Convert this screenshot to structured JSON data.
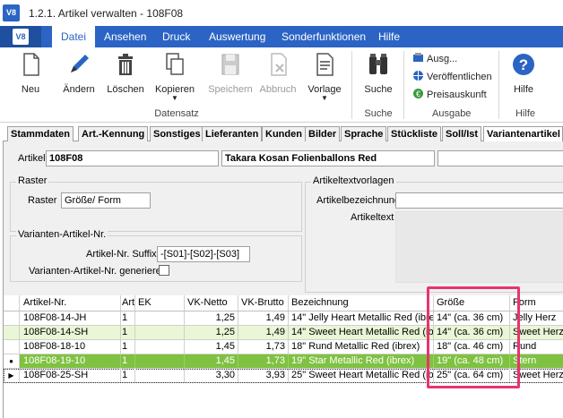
{
  "window": {
    "title": "1.2.1. Artikel verwalten - 108F08",
    "app_icon": "V8"
  },
  "ribbon_tabs": [
    "Datei",
    "Ansehen",
    "Druck",
    "Auswertung",
    "Sonderfunktionen",
    "Hilfe"
  ],
  "ribbon": {
    "buttons": {
      "neu": "Neu",
      "aendern": "Ändern",
      "loeschen": "Löschen",
      "kopieren": "Kopieren",
      "speichern": "Speichern",
      "abbruch": "Abbruch",
      "vorlage": "Vorlage",
      "suche": "Suche",
      "hilfe": "Hilfe"
    },
    "small": {
      "ausg": "Ausg...",
      "veroeffentlichen": "Veröffentlichen",
      "preisauskunft": "Preisauskunft"
    },
    "groups": {
      "datensatz": "Datensatz",
      "suche": "Suche",
      "ausgabe": "Ausgabe",
      "hilfe": "Hilfe"
    }
  },
  "page_tabs": [
    "Stammdaten",
    "Art.-Kennung",
    "Sonstiges",
    "Lieferanten",
    "Kunden",
    "Bilder",
    "Sprache",
    "Stückliste",
    "Soll/Ist",
    "Variantenartikel"
  ],
  "artikel": {
    "label": "Artikel",
    "number": "108F08",
    "name": "Takara Kosan Folienballons Red"
  },
  "raster": {
    "group": "Raster",
    "label": "Raster",
    "value": "Größe/ Form"
  },
  "varianten": {
    "group": "Varianten-Artikel-Nr.",
    "suffix_label": "Artikel-Nr. Suffix",
    "suffix_value": "-[S01]-[S02]-[S03]",
    "generate_label": "Varianten-Artikel-Nr. generieren"
  },
  "textvorlagen": {
    "group": "Artikeltextvorlagen",
    "bezeichnung": "Artikelbezeichnung",
    "artikeltext": "Artikeltext"
  },
  "grid": {
    "headers": [
      "Artikel-Nr.",
      "Art",
      "EK",
      "VK-Netto",
      "VK-Brutto",
      "Bezeichnung",
      "Größe",
      "Form"
    ],
    "rows": [
      [
        "108F08-14-JH",
        "1",
        "",
        "1,25",
        "1,49",
        "14\" Jelly Heart Metallic Red (ibrex)",
        "14\" (ca. 36 cm)",
        "Jelly Herz"
      ],
      [
        "108F08-14-SH",
        "1",
        "",
        "1,25",
        "1,49",
        "14\" Sweet Heart Metallic Red (ibrex)",
        "14\" (ca. 36 cm)",
        "Sweet Herz"
      ],
      [
        "108F08-18-10",
        "1",
        "",
        "1,45",
        "1,73",
        "18\" Rund Metallic Red (ibrex)",
        "18\" (ca. 46 cm)",
        "Rund"
      ],
      [
        "108F08-19-10",
        "1",
        "",
        "1,45",
        "1,73",
        "19\" Star Metallic Red (ibrex)",
        "19\" (ca. 48 cm)",
        "Stern"
      ],
      [
        "108F08-25-SH",
        "1",
        "",
        "3,30",
        "3,93",
        "25\" Sweet Heart Metallic Red (ibrex)",
        "25\" (ca. 64 cm)",
        "Sweet Herz"
      ]
    ]
  }
}
